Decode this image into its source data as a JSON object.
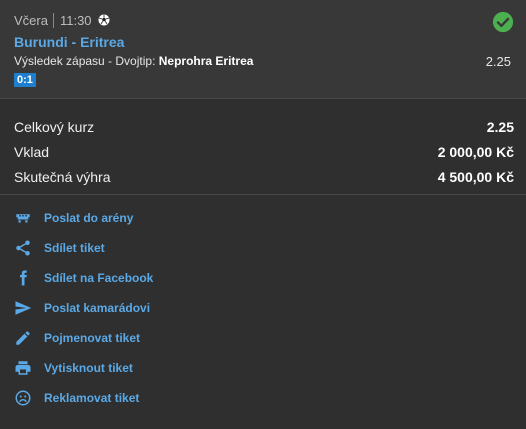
{
  "match": {
    "day": "Včera",
    "time": "11:30",
    "sport_icon": "soccer-ball-icon",
    "status_icon": "check-circle-icon",
    "status_color": "#4caf50",
    "teams": "Burundi - Eritrea",
    "market": "Výsledek zápasu - Dvojtip: ",
    "selection": "Neprohra Eritrea",
    "odd": "2.25",
    "score": "0:1"
  },
  "summary": {
    "total_odds_label": "Celkový kurz",
    "total_odds_value": "2.25",
    "stake_label": "Vklad",
    "stake_value": "2 000,00 Kč",
    "win_label": "Skutečná výhra",
    "win_value": "4 500,00 Kč"
  },
  "actions": [
    {
      "label": "Poslat do arény",
      "icon": "arena-icon"
    },
    {
      "label": "Sdílet tiket",
      "icon": "share-icon"
    },
    {
      "label": "Sdílet na Facebook",
      "icon": "facebook-icon"
    },
    {
      "label": "Poslat kamarádovi",
      "icon": "send-icon"
    },
    {
      "label": "Pojmenovat tiket",
      "icon": "pencil-icon"
    },
    {
      "label": "Vytisknout tiket",
      "icon": "printer-icon"
    },
    {
      "label": "Reklamovat tiket",
      "icon": "sad-face-icon"
    }
  ],
  "colors": {
    "accent": "#5aa9e6",
    "score_badge": "#1e7fd1",
    "background": "#2f2f2f",
    "match_background": "#383838"
  }
}
